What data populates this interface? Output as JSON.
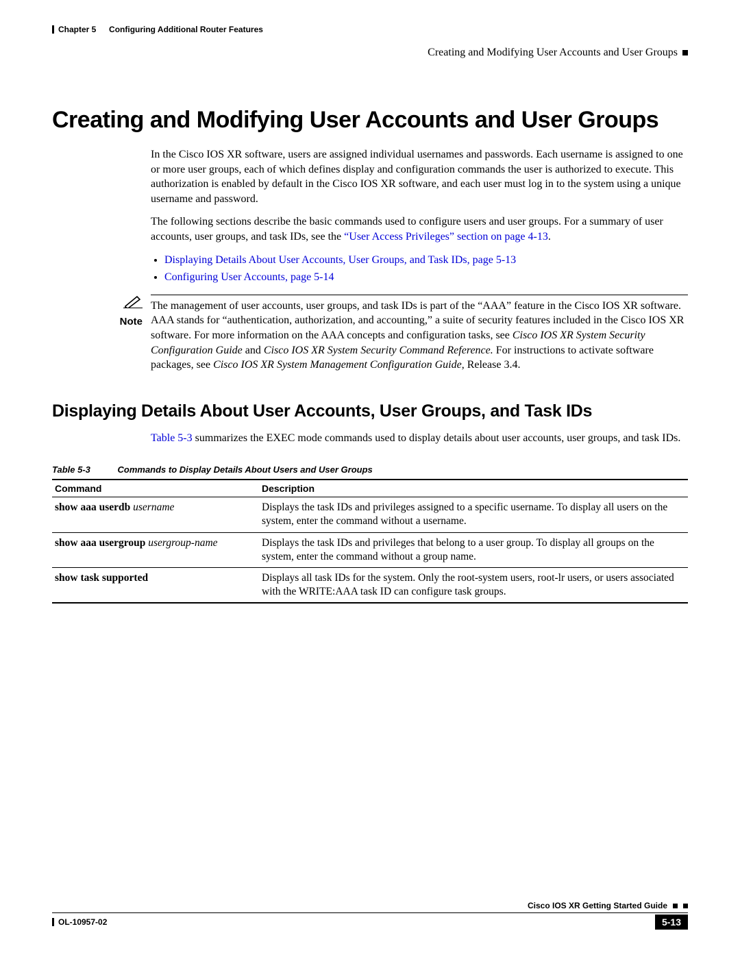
{
  "header": {
    "chapter_label": "Chapter 5",
    "chapter_title": "Configuring Additional Router Features",
    "section_title": "Creating and Modifying User Accounts and User Groups"
  },
  "h1": "Creating and Modifying User Accounts and User Groups",
  "intro_p1": "In the Cisco IOS XR software, users are assigned individual usernames and passwords. Each username is assigned to one or more user groups, each of which defines display and configuration commands the user is authorized to execute. This authorization is enabled by default in the Cisco IOS XR software, and each user must log in to the system using a unique username and password.",
  "intro_p2_a": "The following sections describe the basic commands used to configure users and user groups. For a summary of user accounts, user groups, and task IDs, see the ",
  "intro_p2_link": "“User Access Privileges” section on page 4-13",
  "intro_p2_b": ".",
  "bullets": [
    "Displaying Details About User Accounts, User Groups, and Task IDs, page 5-13",
    "Configuring User Accounts, page 5-14"
  ],
  "note": {
    "label": "Note",
    "text_a": "The management of user accounts, user groups, and task IDs is part of the “AAA” feature in the Cisco IOS XR software. AAA stands for “authentication, authorization, and accounting,” a suite of security features included in the Cisco IOS XR software. For more information on the AAA concepts and configuration tasks, see ",
    "ital1": "Cisco IOS XR System Security Configuration Guide",
    "mid1": " and ",
    "ital2": "Cisco IOS XR System Security Command Reference.",
    "mid2": " For instructions to activate software packages, see ",
    "ital3": "Cisco IOS XR System Management Configuration Guide",
    "tail": ", Release 3.4."
  },
  "h2": "Displaying Details About User Accounts, User Groups, and Task IDs",
  "sub_intro_link": "Table 5-3",
  "sub_intro_rest": " summarizes the EXEC mode commands used to display details about user accounts, user groups, and task IDs.",
  "table": {
    "caption_label": "Table 5-3",
    "caption_text": "Commands to Display Details About Users and User Groups",
    "col_command": "Command",
    "col_description": "Description",
    "rows": [
      {
        "cmd_bold": "show aaa userdb",
        "cmd_ital": "username",
        "desc": "Displays the task IDs and privileges assigned to a specific username. To display all users on the system, enter the command without a username."
      },
      {
        "cmd_bold": "show aaa usergroup",
        "cmd_ital": "usergroup-name",
        "desc": "Displays the task IDs and privileges that belong to a user group. To display all groups on the system, enter the command without a group name."
      },
      {
        "cmd_bold": "show task supported",
        "cmd_ital": "",
        "desc": "Displays all task IDs for the system. Only the root-system users, root-lr users, or users associated with the WRITE:AAA task ID can configure task groups."
      }
    ]
  },
  "footer": {
    "guide": "Cisco IOS XR Getting Started Guide",
    "doc_id": "OL-10957-02",
    "page": "5-13"
  }
}
